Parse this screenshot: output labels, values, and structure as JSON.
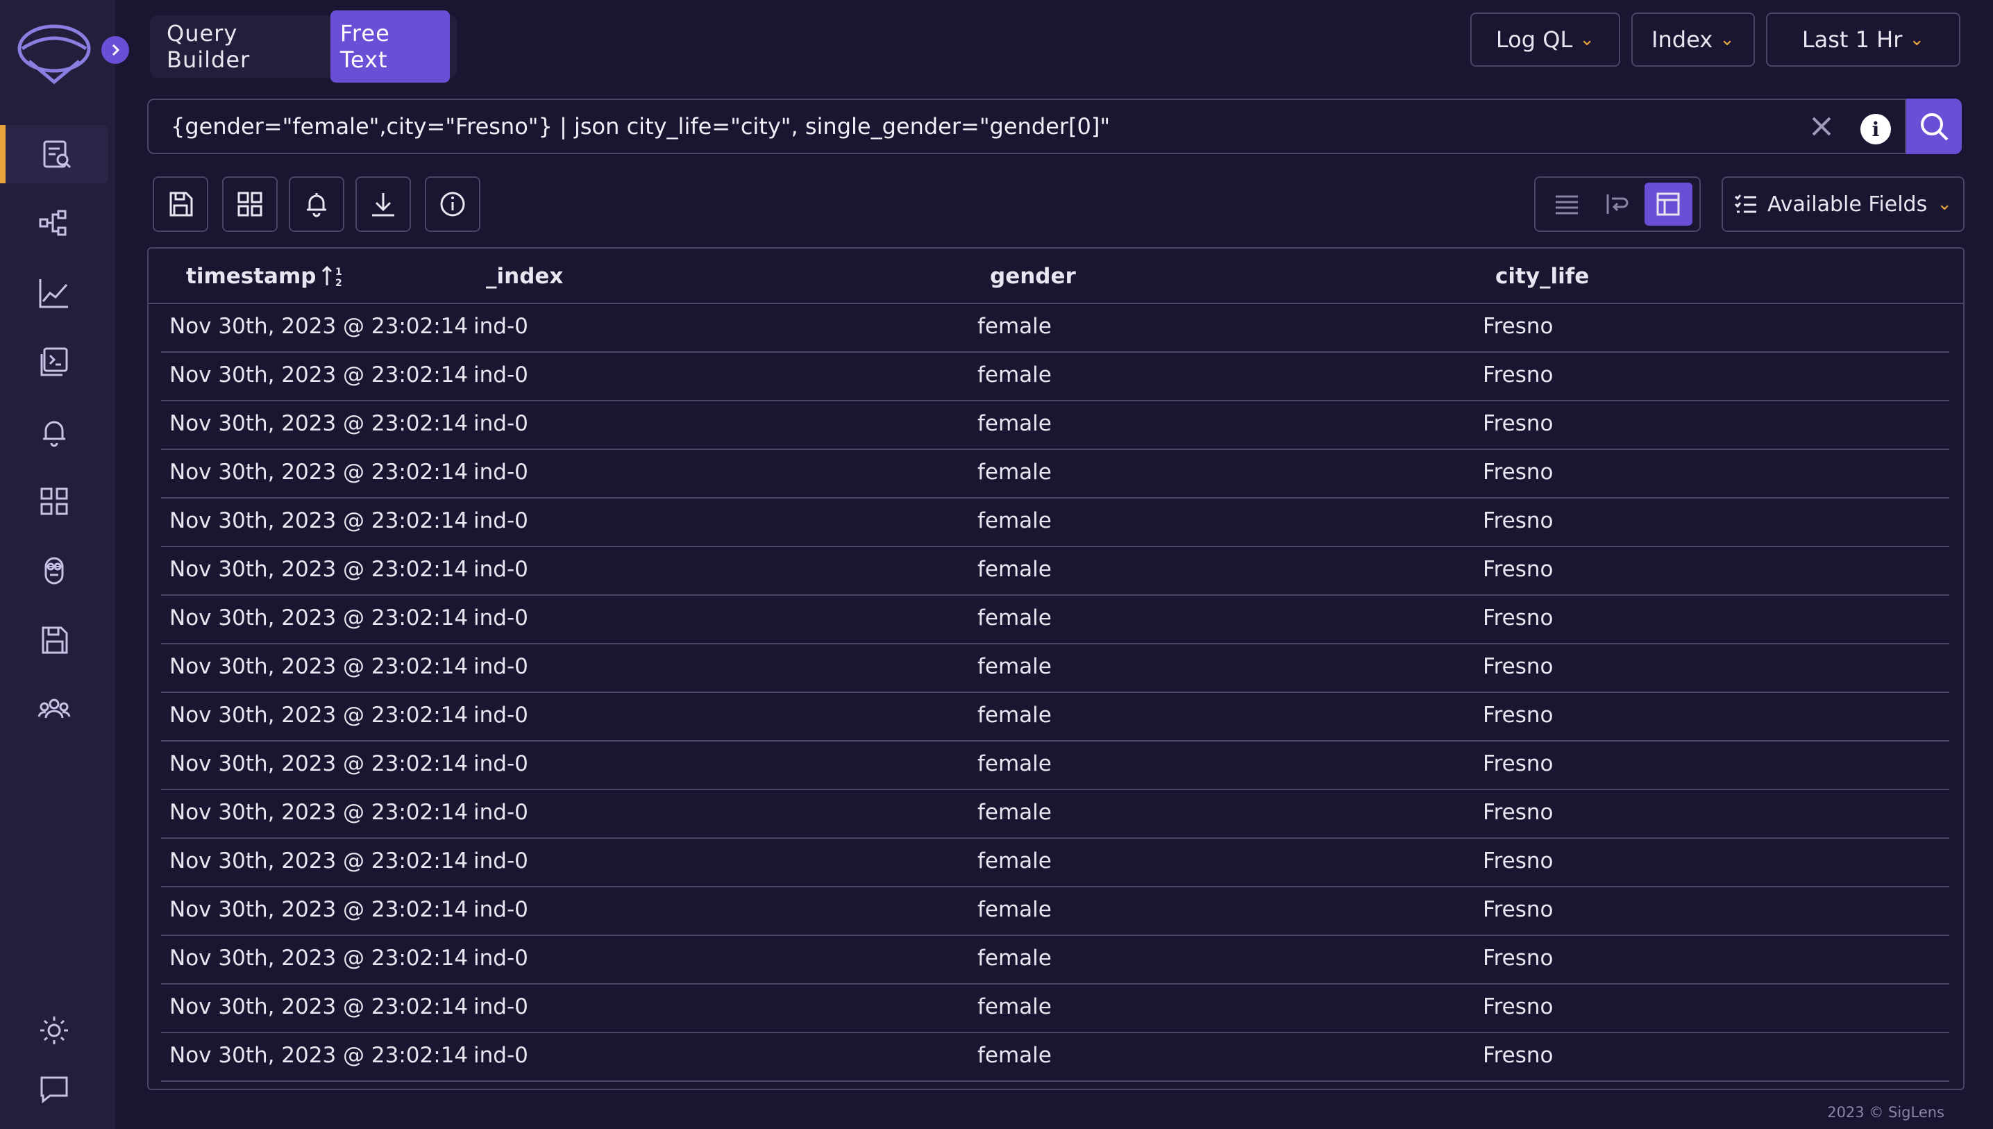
{
  "app": {
    "brand": "SigLens"
  },
  "mode": {
    "options": [
      "Query Builder",
      "Free Text"
    ],
    "selected": "Free Text"
  },
  "dropdowns": {
    "language": "Log QL",
    "index": "Index",
    "time_range": "Last 1 Hr"
  },
  "query": {
    "text": "{gender=\"female\",city=\"Fresno\"} | json city_life=\"city\", single_gender=\"gender[0]\""
  },
  "toolbar": {
    "icons": [
      "save-icon",
      "dashboard-icon",
      "alert-icon",
      "download-icon",
      "info-icon"
    ],
    "view_modes": [
      "list-view",
      "wrap-view",
      "table-view"
    ],
    "selected_view": "table-view",
    "available_fields_label": "Available Fields"
  },
  "table": {
    "columns": [
      "timestamp",
      "_index",
      "gender",
      "city_life"
    ],
    "sort_icon": "sort-ascending-icon",
    "rows": [
      [
        "Nov 30th, 2023 @ 23:02:14",
        "ind-0",
        "female",
        "Fresno"
      ],
      [
        "Nov 30th, 2023 @ 23:02:14",
        "ind-0",
        "female",
        "Fresno"
      ],
      [
        "Nov 30th, 2023 @ 23:02:14",
        "ind-0",
        "female",
        "Fresno"
      ],
      [
        "Nov 30th, 2023 @ 23:02:14",
        "ind-0",
        "female",
        "Fresno"
      ],
      [
        "Nov 30th, 2023 @ 23:02:14",
        "ind-0",
        "female",
        "Fresno"
      ],
      [
        "Nov 30th, 2023 @ 23:02:14",
        "ind-0",
        "female",
        "Fresno"
      ],
      [
        "Nov 30th, 2023 @ 23:02:14",
        "ind-0",
        "female",
        "Fresno"
      ],
      [
        "Nov 30th, 2023 @ 23:02:14",
        "ind-0",
        "female",
        "Fresno"
      ],
      [
        "Nov 30th, 2023 @ 23:02:14",
        "ind-0",
        "female",
        "Fresno"
      ],
      [
        "Nov 30th, 2023 @ 23:02:14",
        "ind-0",
        "female",
        "Fresno"
      ],
      [
        "Nov 30th, 2023 @ 23:02:14",
        "ind-0",
        "female",
        "Fresno"
      ],
      [
        "Nov 30th, 2023 @ 23:02:14",
        "ind-0",
        "female",
        "Fresno"
      ],
      [
        "Nov 30th, 2023 @ 23:02:14",
        "ind-0",
        "female",
        "Fresno"
      ],
      [
        "Nov 30th, 2023 @ 23:02:14",
        "ind-0",
        "female",
        "Fresno"
      ],
      [
        "Nov 30th, 2023 @ 23:02:14",
        "ind-0",
        "female",
        "Fresno"
      ],
      [
        "Nov 30th, 2023 @ 23:02:14",
        "ind-0",
        "female",
        "Fresno"
      ]
    ]
  },
  "sidebar": {
    "items": [
      "search-icon",
      "service-graph-icon",
      "metrics-icon",
      "console-icon",
      "alerts-icon",
      "dashboards-icon",
      "minion-icon",
      "saved-queries-icon",
      "users-icon"
    ],
    "active": "search-icon",
    "bottom": [
      "theme-toggle-icon",
      "feedback-icon"
    ]
  },
  "footer": {
    "copyright": "2023 © SigLens"
  },
  "colors": {
    "background": "#1a1530",
    "sidebar": "#231e3b",
    "accent": "#6a4fd6",
    "highlight": "#e8a33d",
    "border": "#4a4466"
  }
}
